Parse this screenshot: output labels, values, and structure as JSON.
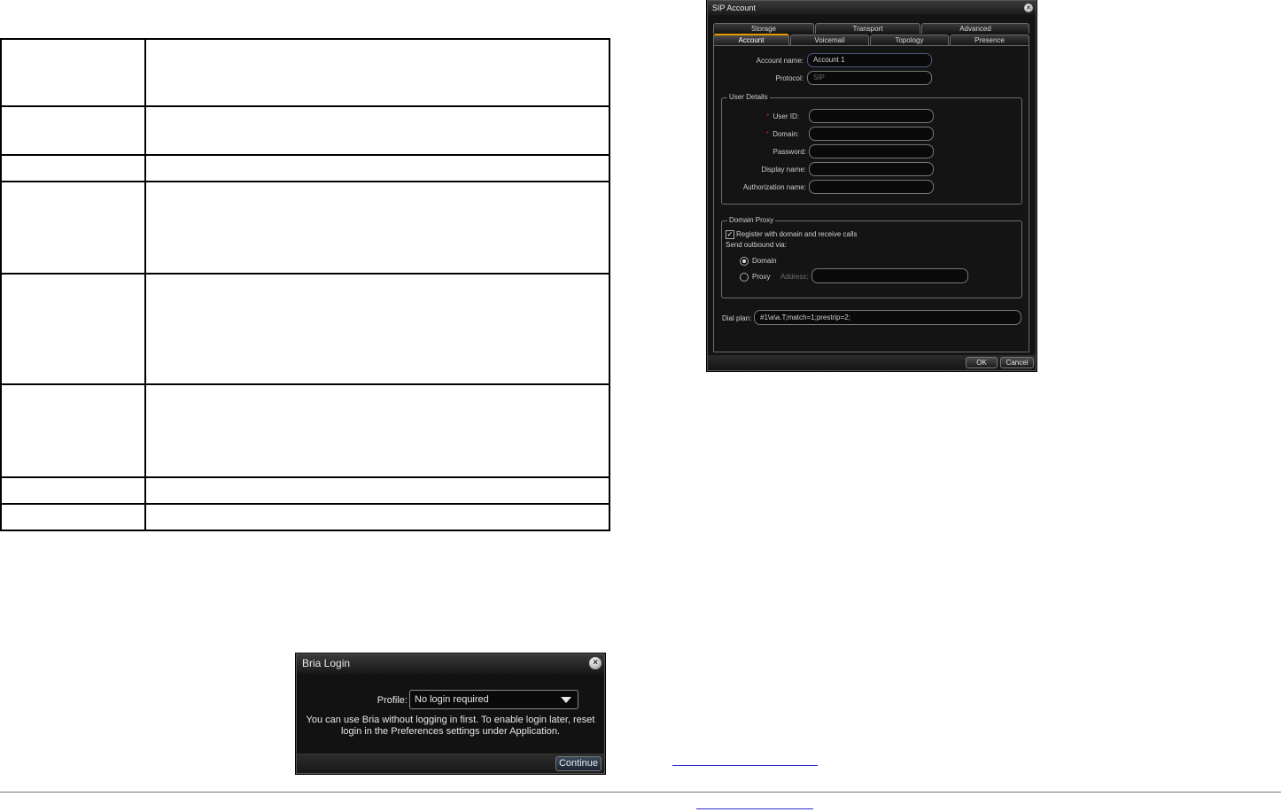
{
  "table": {
    "rows": [
      {
        "label": "",
        "desc": ""
      },
      {
        "label": "",
        "desc": ""
      },
      {
        "label": "",
        "desc": ""
      },
      {
        "label": "",
        "desc": ""
      },
      {
        "label": "",
        "desc": ""
      },
      {
        "label": "",
        "desc": ""
      },
      {
        "label": "",
        "desc": ""
      },
      {
        "label": "",
        "desc": ""
      }
    ]
  },
  "sip_account": {
    "title": "SIP Account",
    "close_icon": "close-x",
    "tabs_top": [
      "Storage",
      "Transport",
      "Advanced"
    ],
    "tabs_bottom": [
      "Account",
      "Voicemail",
      "Topology",
      "Presence"
    ],
    "active_tab": "Account",
    "account_name_label": "Account name:",
    "account_name_value": "Account 1",
    "protocol_label": "Protocol:",
    "protocol_value": "SIP",
    "user_details": {
      "title": "User Details",
      "required_mark": "*",
      "user_id_label": "User ID:",
      "domain_label": "Domain:",
      "password_label": "Password:",
      "display_name_label": "Display name:",
      "authorization_name_label": "Authorization name:"
    },
    "domain_proxy": {
      "title": "Domain Proxy",
      "register_label": "Register with domain and receive calls",
      "register_checked": true,
      "send_outbound_label": "Send outbound via:",
      "domain_option": "Domain",
      "proxy_option": "Proxy",
      "selected": "Domain",
      "address_label": "Address:",
      "address_value": ""
    },
    "dial_plan_label": "Dial plan:",
    "dial_plan_value": "#1\\a\\a.T;match=1;prestrip=2;",
    "ok_label": "OK",
    "cancel_label": "Cancel"
  },
  "bria_login": {
    "title": "Bria Login",
    "close_icon": "close-x",
    "profile_label": "Profile:",
    "profile_value": "No login required",
    "message_line1": "You can use Bria without logging in first. To enable login later, reset",
    "message_line2": "login in the Preferences settings under Application.",
    "continue_label": "Continue"
  },
  "colors": {
    "dialog_bg": "#141414",
    "active_tab_accent": "#e59b00",
    "required_mark": "#c02020",
    "link_underline": "#2a2ad0"
  }
}
